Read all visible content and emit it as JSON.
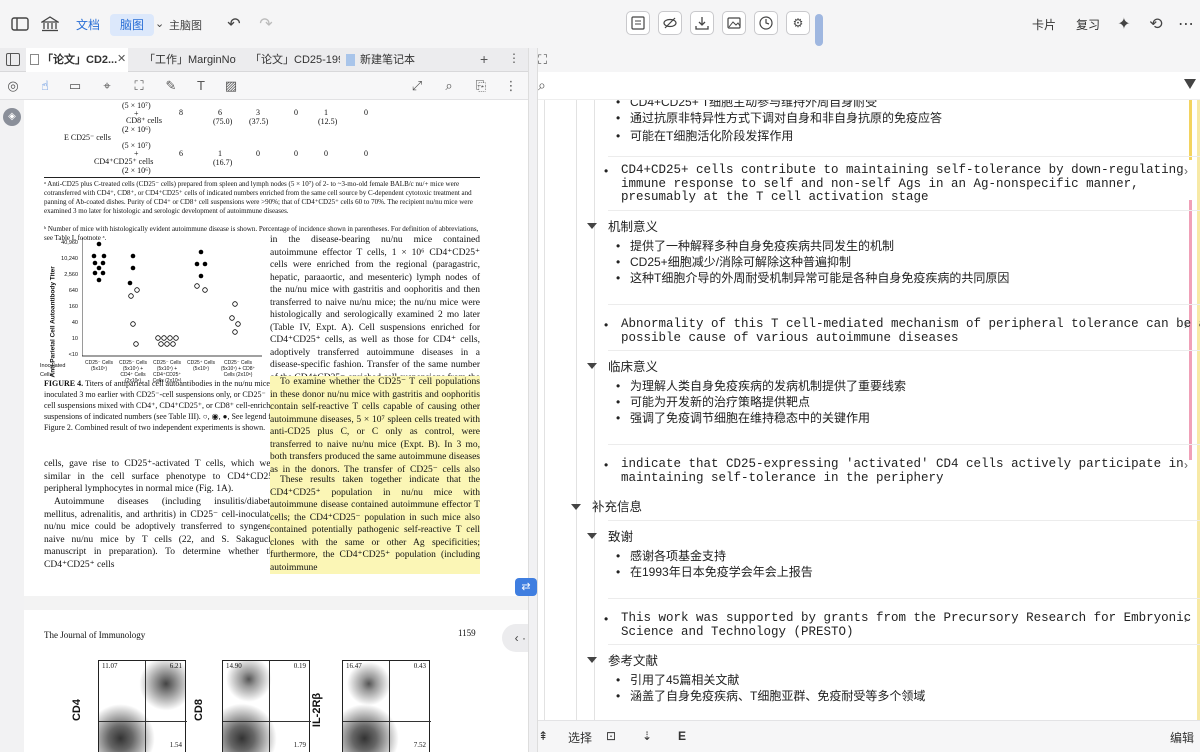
{
  "topbar": {
    "tab_doc": "文档",
    "tab_mindmap": "脑图",
    "theme_label": "主脑图",
    "card_label": "卡片",
    "review_label": "复习"
  },
  "doc_tabs": [
    {
      "label": "「论文」CD2..."
    },
    {
      "label": "「工作」MarginNote-..."
    },
    {
      "label": "「论文」CD25-1995..."
    },
    {
      "label": "新建笔记本"
    }
  ],
  "doc": {
    "table_rows": [
      {
        "text": "(5 × 10⁷)",
        "vals": []
      },
      {
        "text": "+",
        "vals": []
      },
      {
        "text": "CD8⁺ cells",
        "vals": [
          "8",
          "6",
          "3",
          "0",
          "1",
          "0"
        ]
      },
      {
        "text": "(2 × 10⁶)",
        "vals": [
          "",
          "(75.0)",
          "(37.5)",
          "",
          "(12.5)",
          ""
        ]
      },
      {
        "text": "E   CD25⁻ cells",
        "vals": []
      },
      {
        "text": "(5 × 10⁷)",
        "vals": []
      },
      {
        "text": "+",
        "vals": []
      },
      {
        "text": "CD4⁺CD25⁺ cells",
        "vals": [
          "6",
          "1",
          "0",
          "0",
          "0",
          "0"
        ]
      },
      {
        "text": "(2 × 10⁶)",
        "vals": [
          "",
          "(16.7)",
          "",
          "",
          "",
          ""
        ]
      }
    ],
    "footnote1": "ᵃ Anti-CD25 plus C-treated cells (CD25⁻ cells) prepared from spleen and lymph nodes (5 × 10⁷) of 2- to ~3-mo-old female BALB/c nu/+ mice were cotransferred with CD4⁺, CD8⁺, or CD4⁺CD25⁺ cells of indicated numbers enriched from the same cell source by C-dependent cytotoxic treatment and panning of Ab-coated dishes. Purity of CD4⁺ or CD8⁺ cell suspensions were >90%; that of CD4⁺CD25⁺ cells 60 to 70%. The recipient nu/nu mice were examined 3 mo later for histologic and serologic development of autoimmune diseases.",
    "footnote2": "ᵇ Number of mice with histologically evident autoimmune disease is shown. Percentage of incidence shown in parentheses. For definition of abbreviations, see Table I, footnote ᵃ.",
    "chart_y_label": "Anti-Parietal Cell Autoantibody Titer",
    "chart_y_ticks": [
      "40,960",
      "10,240",
      "2,560",
      "640",
      "160",
      "40",
      "10",
      "<10"
    ],
    "chart_x_label": "Inoculated Cells:",
    "chart_groups": [
      "CD25⁻ Cells (5x10⁷)",
      "CD25⁻ Cells (5x10⁷) + CD4⁺ Cells (2x10⁶)",
      "CD25⁻ Cells (5x10⁷) + CD4⁺CD25⁺ Cells (2x10⁶)",
      "CD25⁺ Cells (5x10⁷)",
      "CD25⁻ Cells (5x10⁷) + CD8⁺ Cells (2x10⁶)"
    ],
    "fig_caption_title": "FIGURE 4.",
    "fig_caption": "Titers of antiparietal cell autoantibodies in the nu/nu mice inoculated 3 mo earlier with CD25⁻-cell suspensions only, or CD25⁻ cell suspensions mixed with CD4⁺, CD4⁺CD25⁺, or CD8⁺ cell-enriched suspensions of indicated numbers (see Table III). ○, ◉, ●, See legend for Figure 2. Combined result of two independent experiments is shown.",
    "left_para": "cells, gave rise to CD25⁺-activated T cells, which were similar in the cell surface phenotype to CD4⁺CD25⁺ peripheral lymphocytes in normal mice (Fig. 1A).",
    "left_para2": "Autoimmune diseases (including insulitis/diabetes mellitus, adrenalitis, and arthritis) in CD25⁻ cell-inoculated nu/nu mice could be adoptively transferred to syngeneic naive nu/nu mice by T cells (22, and S. Sakaguchi, manuscript in preparation). To determine whether the CD4⁺CD25⁺ cells",
    "right_para1": "in the disease-bearing nu/nu mice contained autoimmune effector T cells, 1 × 10⁶ CD4⁺CD25⁺ cells were enriched from the regional (paragastric, hepatic, paraaortic, and mesenteric) lymph nodes of the nu/nu mice with gastritis and oophoritis and then transferred to naive nu/nu mice; the nu/nu mice were histologically and serologically examined 2 mo later (Table IV, Expt. A). Cell suspensions enriched for CD4⁺CD25⁺ cells, as well as those for CD4⁺ cells, adoptively transferred autoimmune diseases in a disease-specific fashion. Transfer of the same number of the CD4⁺CD25⁻-enriched cell suspensions from the same nu/nu mice also produced similar autoimmune diseases, although at lower incidences.",
    "right_para2": "To examine whether the CD25⁻ T cell populations in these donor nu/nu mice with gastritis and oophoritis contain self-reactive T cells capable of causing other autoimmune diseases, 5 × 10⁷ spleen cells treated with anti-CD25 plus C, or C only as control, were transferred to naive nu/nu mice (Expt. B). In 3 mo, both transfers produced the same autoimmune diseases as in the donors. The transfer of CD25⁻ cells also induced thyroiditis de novo, whereas the control transfer did not.",
    "right_para3": "These results taken together indicate that the CD4⁺CD25⁺ population in nu/nu mice with autoimmune disease contained autoimmune effector T cells; the CD4⁺CD25⁻ population in such mice also contained potentially pathogenic self-reactive T cell clones with the same or other Ag specificities; furthermore, the CD4⁺CD25⁺ population (including autoimmune",
    "journal": "The Journal of Immunology",
    "page_number": "1159",
    "flow": [
      {
        "axis": "CD4",
        "tl": "11.07",
        "tr": "6.21",
        "br": "1.54"
      },
      {
        "axis": "CD8",
        "tl": "14.90",
        "tr": "0.19",
        "br": "1.79"
      },
      {
        "axis": "IL-2Rβ",
        "tl": "16.47",
        "tr": "0.43",
        "br": "7.52"
      }
    ]
  },
  "mindmap": {
    "top_partial": "CD4+CD25+ T细胞主动参与维持外周自身耐受",
    "s1_items": [
      "通过抗原非特异性方式下调对自身和非自身抗原的免疫应答",
      "可能在T细胞活化阶段发挥作用"
    ],
    "s1_quote": "CD4+CD25+ cells contribute to maintaining self-tolerance by down-regulating\nimmune response to self and non-self Ags in an Ag-nonspecific manner,\npresumably at the T cell activation stage",
    "mech_title": "机制意义",
    "mech_items": [
      "提供了一种解释多种自身免疫疾病共同发生的机制",
      "CD25+细胞减少/消除可解除这种普遍抑制",
      "这种T细胞介导的外周耐受机制异常可能是各种自身免疫疾病的共同原因"
    ],
    "mech_quote": "Abnormality of this T cell-mediated mechanism of peripheral tolerance can be a\npossible cause of various autoimmune diseases",
    "clin_title": "临床意义",
    "clin_items": [
      "为理解人类自身免疫疾病的发病机制提供了重要线索",
      "可能为开发新的治疗策略提供靶点",
      "强调了免疫调节细胞在维持稳态中的关键作用"
    ],
    "clin_quote": "indicate that CD25-expressing 'activated' CD4 cells actively participate in\nmaintaining self-tolerance in the periphery",
    "extra_title": "补充信息",
    "ack_title": "致谢",
    "ack_items": [
      "感谢各项基金支持",
      "在1993年日本免疫学会年会上报告"
    ],
    "ack_quote": "This work was supported by grants from the Precursory Research for Embryonic\nScience and Technology (PRESTO)",
    "ref_title": "参考文献",
    "ref_items": [
      "引用了45篇相关文献",
      "涵盖了自身免疫疾病、T细胞亚群、免疫耐受等多个领域"
    ]
  },
  "bottombar": {
    "select_label": "选择",
    "edit_label": "编辑"
  },
  "colors": {
    "accent_blue": "#2a6fd6",
    "highlight": "#fbf6b6",
    "accent_yellow": "#f3d35f",
    "accent_pink": "#f0a0b8"
  }
}
